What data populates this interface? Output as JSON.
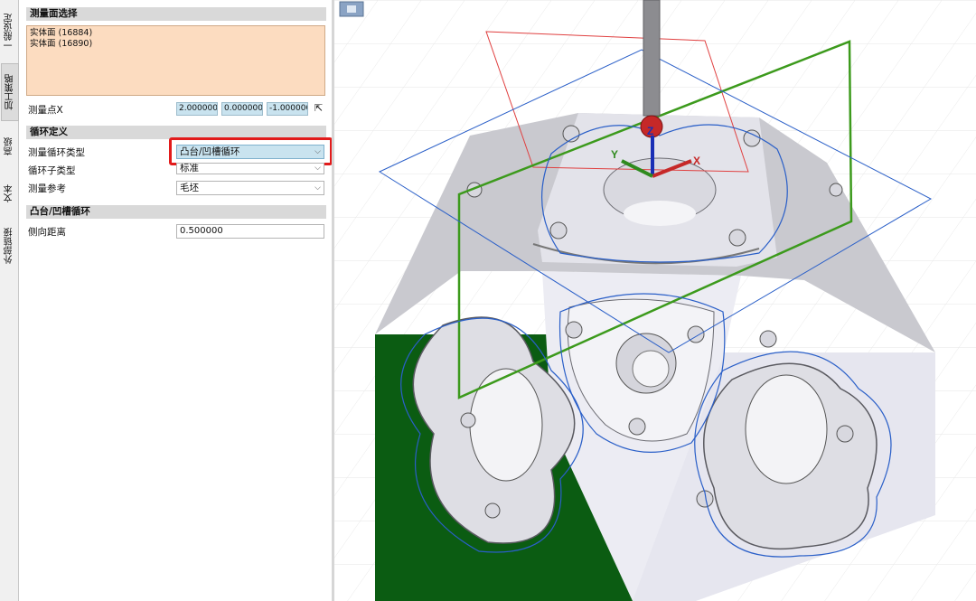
{
  "vertical_tabs": [
    "一般设定",
    "加工策略",
    "高级",
    "文本",
    "外部链接"
  ],
  "active_tab_index": 1,
  "sections": {
    "face_select": "测量面选择",
    "cycle_def": "循环定义",
    "boss_cycle": "凸台/凹槽循环"
  },
  "faces": [
    "实体面 (16884)",
    "实体面 (16890)"
  ],
  "measure_point": {
    "label": "测量点X",
    "x": "2.000000",
    "y": "0.000000",
    "z": "-1.000000"
  },
  "cycle_type": {
    "label": "测量循环类型",
    "value": "凸台/凹槽循环"
  },
  "sub_type": {
    "label": "循环子类型",
    "value": "标准"
  },
  "reference": {
    "label": "测量参考",
    "value": "毛坯"
  },
  "side_distance": {
    "label": "侧向距离",
    "value": "0.500000"
  },
  "axes": {
    "x": "X",
    "y": "Y",
    "z": "Z"
  },
  "colors": {
    "highlight": "#e21b1b",
    "selected_face": "#0b5c12",
    "path": "#2a5fc8",
    "green_plane": "#3c9a1c",
    "red_plane": "#e04040"
  }
}
